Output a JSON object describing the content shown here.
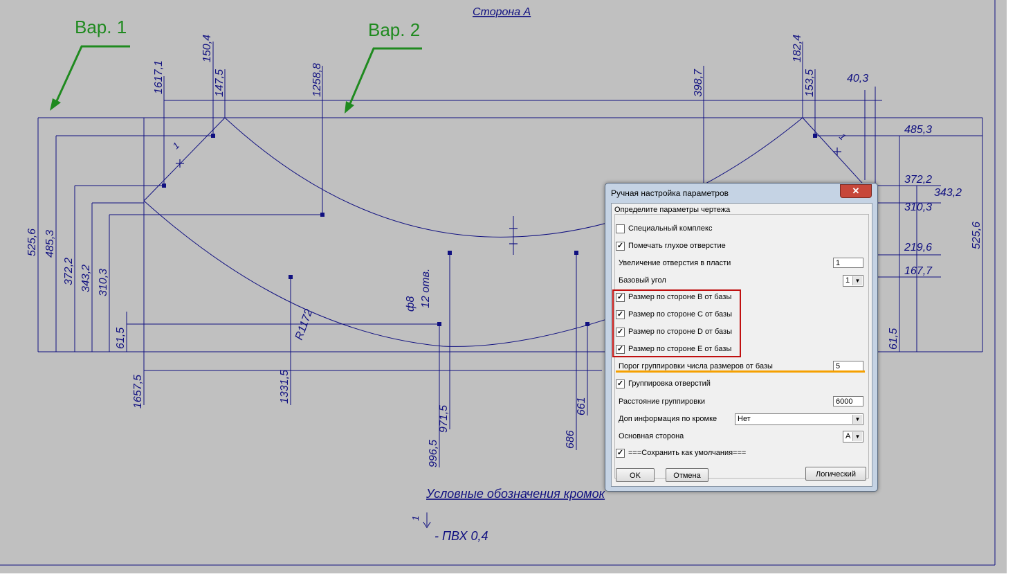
{
  "drawing": {
    "title": "Сторона А",
    "var1_label": "Вар. 1",
    "var2_label": "Вар. 2",
    "legend_title": "Условные обозначения кромок",
    "legend_mark": "1",
    "legend_text": "- ПВХ 0,4",
    "dims": {
      "d1617": "1617,1",
      "d150": "150,4",
      "d147": "147,5",
      "d1258": "1258,8",
      "d398": "398,7",
      "d182": "182,4",
      "d153": "153,5",
      "d40": "40,3",
      "d485r": "485,3",
      "d372r": "372,2",
      "d343r": "343,2",
      "d310r": "310,3",
      "d219r": "219,6",
      "d167r": "167,7",
      "d525r": "525,6",
      "d61r": "61,5",
      "d525l": "525,6",
      "d485l": "485,3",
      "d372l": "372,2",
      "d343l": "343,2",
      "d310l": "310,3",
      "d61l": "61,5",
      "d1657": "1657,5",
      "d1331": "1331,5",
      "d996": "996,5",
      "d971": "971,5",
      "d686": "686",
      "d661": "661",
      "r1172": "R1172",
      "hole_d": "ф8",
      "hole_n": "12 отв.",
      "edge1": "1",
      "edge2": "1"
    }
  },
  "dialog": {
    "title": "Ручная настройка параметров",
    "close_glyph": "✕",
    "group_title": "Определите параметры чертежа",
    "items": [
      {
        "label": "Специальный комплекс",
        "checked": ""
      },
      {
        "label": "Помечать глухое отверстие",
        "checked": "✓"
      },
      {
        "label": "Увеличение отверстия в пласти",
        "value": "1"
      },
      {
        "label": "Базовый угол",
        "value": "1"
      },
      {
        "label": "Размер по стороне B от базы",
        "checked": "✓"
      },
      {
        "label": "Размер по стороне C от базы",
        "checked": "✓"
      },
      {
        "label": "Размер по стороне D от базы",
        "checked": "✓"
      },
      {
        "label": "Размер по стороне E от базы",
        "checked": "✓"
      },
      {
        "label": "Порог группировки числа размеров от базы",
        "value": "5"
      },
      {
        "label": "Группировка отверстий",
        "checked": "✓"
      },
      {
        "label": "Расстояние группировки",
        "value": "6000"
      },
      {
        "label": "Доп информация по кромке",
        "value": "Нет"
      },
      {
        "label": "Основная сторона",
        "value": "A"
      },
      {
        "label": "===Сохранить как умолчания===",
        "checked": "✓"
      }
    ],
    "buttons": {
      "ok": "OK",
      "cancel": "Отмена",
      "logic": "Логический"
    }
  },
  "colors": {
    "background": "#c0c0c0",
    "line": "#101080",
    "arrow": "#1f8a1f",
    "highlight_box": "#c01010",
    "highlight_line": "#f5a000"
  }
}
